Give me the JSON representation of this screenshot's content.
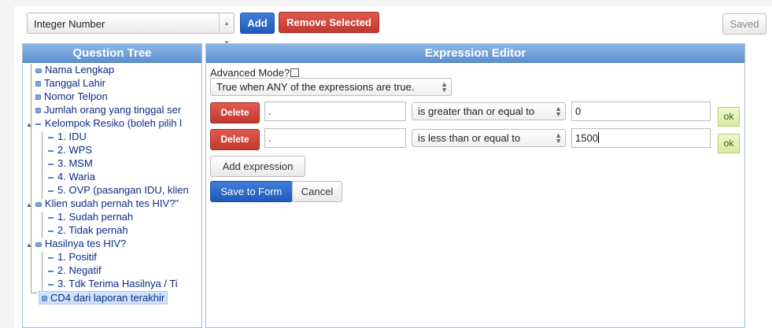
{
  "toolbar": {
    "type_select_value": "Integer Number",
    "add_label": "Add",
    "remove_label": "Remove Selected",
    "saved_label": "Saved"
  },
  "tree": {
    "title": "Question Tree",
    "items": [
      {
        "label": "Nama Lengkap"
      },
      {
        "label": "Tanggal Lahir"
      },
      {
        "label": "Nomor Telpon"
      },
      {
        "label": "Jumlah orang yang tinggal ser"
      },
      {
        "label": "Kelompok Resiko (boleh pilih l"
      },
      {
        "label": "1. IDU"
      },
      {
        "label": "2. WPS"
      },
      {
        "label": "3. MSM"
      },
      {
        "label": "4. Waria"
      },
      {
        "label": "5. OVP (pasangan IDU, klien"
      },
      {
        "label": "Klien sudah pernah tes HIV?\""
      },
      {
        "label": "1. Sudah pernah"
      },
      {
        "label": "2. Tidak pernah"
      },
      {
        "label": "Hasilnya tes HIV?"
      },
      {
        "label": "1. Positif"
      },
      {
        "label": "2. Negatif"
      },
      {
        "label": "3. Tdk Terima Hasilnya / Ti"
      },
      {
        "label": "CD4 dari laporan terakhir"
      }
    ]
  },
  "editor": {
    "title": "Expression Editor",
    "advanced_label": "Advanced Mode?",
    "match_select": "True when ANY of the expressions are true.",
    "rows": [
      {
        "delete_label": "Delete",
        "field": ".",
        "operator": "is greater than or equal to",
        "value": "0",
        "ok_label": "ok"
      },
      {
        "delete_label": "Delete",
        "field": ".",
        "operator": "is less than or equal to",
        "value": "1500",
        "ok_label": "ok"
      }
    ],
    "add_expression_label": "Add expression",
    "save_label": "Save to Form",
    "cancel_label": "Cancel"
  }
}
